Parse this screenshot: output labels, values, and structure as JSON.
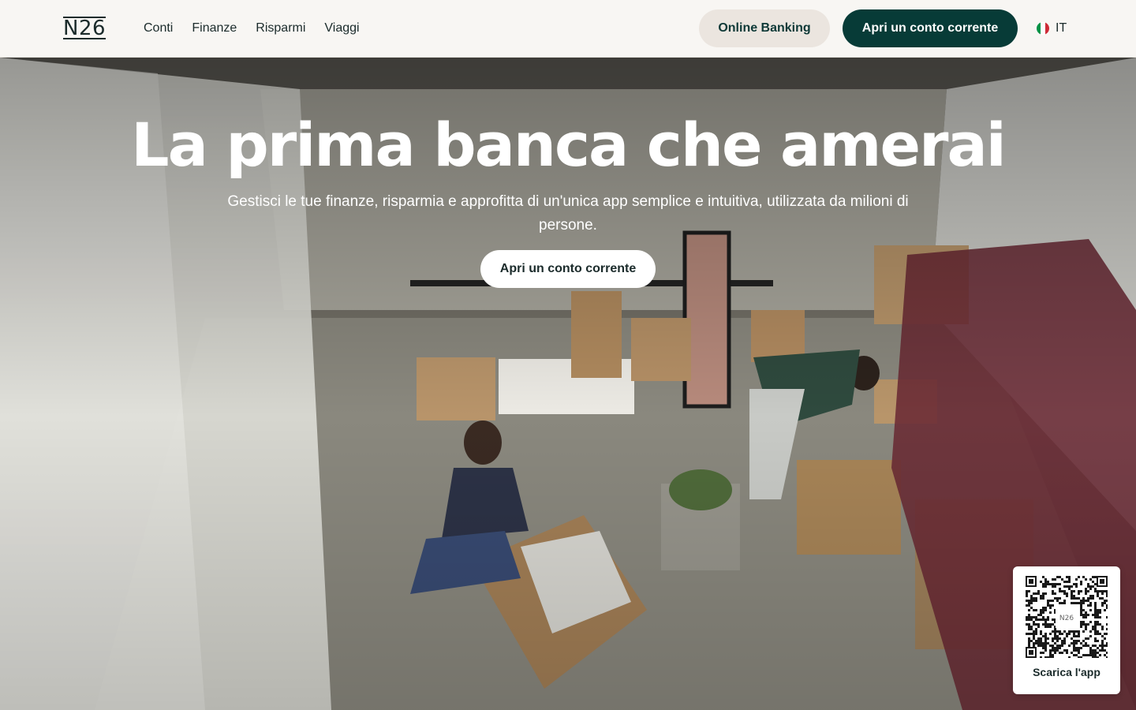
{
  "header": {
    "logo_text": "N26",
    "nav": [
      {
        "label": "Conti"
      },
      {
        "label": "Finanze"
      },
      {
        "label": "Risparmi"
      },
      {
        "label": "Viaggi"
      }
    ],
    "online_banking_label": "Online Banking",
    "open_account_label": "Apri un conto corrente",
    "language": {
      "code": "IT",
      "flag_icon": "italy-flag-icon"
    }
  },
  "hero": {
    "title": "La prima banca che amerai",
    "subtitle": "Gestisci le tue finanze, risparmia e approfitta di un'unica app semplice e intuitiva, utilizzata da milioni di persone.",
    "cta_label": "Apri un conto corrente",
    "image": "photo of a couple unpacking moving boxes in a new apartment"
  },
  "qr_card": {
    "label": "Scarica l'app",
    "center_text": "N26"
  },
  "colors": {
    "brand_dark": "#073b37",
    "header_bg": "#f8f6f3",
    "secondary_button_bg": "#ebe5df",
    "white": "#ffffff"
  }
}
